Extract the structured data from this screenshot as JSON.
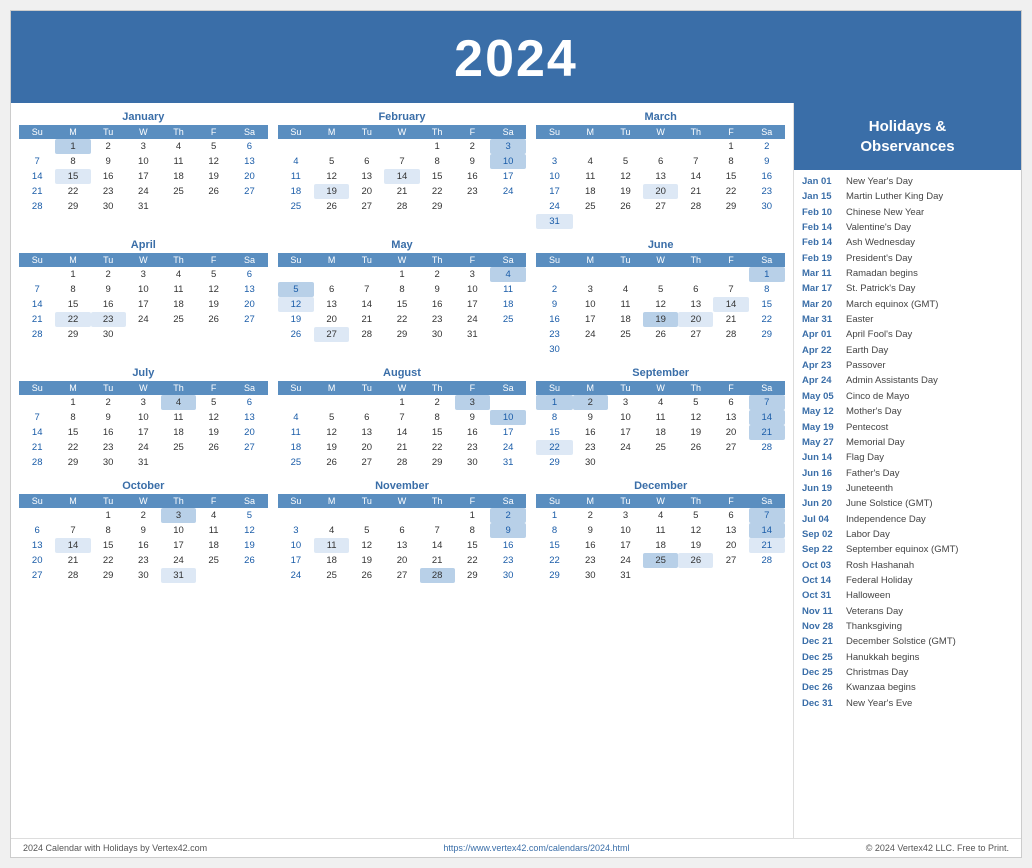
{
  "header": {
    "year": "2024"
  },
  "sidebar": {
    "title": "Holidays &\nObservances",
    "events": [
      {
        "date": "Jan 01",
        "event": "New Year's Day"
      },
      {
        "date": "Jan 15",
        "event": "Martin Luther King Day"
      },
      {
        "date": "Feb 10",
        "event": "Chinese New Year"
      },
      {
        "date": "Feb 14",
        "event": "Valentine's Day"
      },
      {
        "date": "Feb 14",
        "event": "Ash Wednesday"
      },
      {
        "date": "Feb 19",
        "event": "President's Day"
      },
      {
        "date": "Mar 11",
        "event": "Ramadan begins"
      },
      {
        "date": "Mar 17",
        "event": "St. Patrick's Day"
      },
      {
        "date": "Mar 20",
        "event": "March equinox (GMT)"
      },
      {
        "date": "Mar 31",
        "event": "Easter"
      },
      {
        "date": "Apr 01",
        "event": "April Fool's Day"
      },
      {
        "date": "Apr 22",
        "event": "Earth Day"
      },
      {
        "date": "Apr 23",
        "event": "Passover"
      },
      {
        "date": "Apr 24",
        "event": "Admin Assistants Day"
      },
      {
        "date": "May 05",
        "event": "Cinco de Mayo"
      },
      {
        "date": "May 12",
        "event": "Mother's Day"
      },
      {
        "date": "May 19",
        "event": "Pentecost"
      },
      {
        "date": "May 27",
        "event": "Memorial Day"
      },
      {
        "date": "Jun 14",
        "event": "Flag Day"
      },
      {
        "date": "Jun 16",
        "event": "Father's Day"
      },
      {
        "date": "Jun 19",
        "event": "Juneteenth"
      },
      {
        "date": "Jun 20",
        "event": "June Solstice (GMT)"
      },
      {
        "date": "Jul 04",
        "event": "Independence Day"
      },
      {
        "date": "Sep 02",
        "event": "Labor Day"
      },
      {
        "date": "Sep 22",
        "event": "September equinox (GMT)"
      },
      {
        "date": "Oct 03",
        "event": "Rosh Hashanah"
      },
      {
        "date": "Oct 14",
        "event": "Federal Holiday"
      },
      {
        "date": "Oct 31",
        "event": "Halloween"
      },
      {
        "date": "Nov 11",
        "event": "Veterans Day"
      },
      {
        "date": "Nov 28",
        "event": "Thanksgiving"
      },
      {
        "date": "Dec 21",
        "event": "December Solstice (GMT)"
      },
      {
        "date": "Dec 25",
        "event": "Hanukkah begins"
      },
      {
        "date": "Dec 25",
        "event": "Christmas Day"
      },
      {
        "date": "Dec 26",
        "event": "Kwanzaa begins"
      },
      {
        "date": "Dec 31",
        "event": "New Year's Eve"
      }
    ]
  },
  "footer": {
    "left": "2024 Calendar with Holidays by Vertex42.com",
    "center": "https://www.vertex42.com/calendars/2024.html",
    "right": "© 2024 Vertex42 LLC. Free to Print."
  },
  "months": [
    {
      "name": "January",
      "weeks": [
        [
          "",
          "1",
          "2",
          "3",
          "4",
          "5",
          "6"
        ],
        [
          "7",
          "8",
          "9",
          "10",
          "11",
          "12",
          "13"
        ],
        [
          "14",
          "15",
          "16",
          "17",
          "18",
          "19",
          "20"
        ],
        [
          "21",
          "22",
          "23",
          "24",
          "25",
          "26",
          "27"
        ],
        [
          "28",
          "29",
          "30",
          "31",
          "",
          "",
          ""
        ]
      ],
      "highlighted": {
        "1": "holiday",
        "15": "special"
      },
      "blue_sunday": []
    },
    {
      "name": "February",
      "weeks": [
        [
          "",
          "",
          "",
          "",
          "1",
          "2",
          "3"
        ],
        [
          "4",
          "5",
          "6",
          "7",
          "8",
          "9",
          "10"
        ],
        [
          "11",
          "12",
          "13",
          "14",
          "15",
          "16",
          "17"
        ],
        [
          "18",
          "19",
          "20",
          "21",
          "22",
          "23",
          "24"
        ],
        [
          "25",
          "26",
          "27",
          "28",
          "29",
          "",
          ""
        ]
      ],
      "highlighted": {
        "3": "saturday-blue",
        "10": "holiday",
        "14": "special",
        "19": "special"
      }
    },
    {
      "name": "March",
      "weeks": [
        [
          "",
          "",
          "",
          "",
          "",
          "1",
          "2"
        ],
        [
          "3",
          "4",
          "5",
          "6",
          "7",
          "8",
          "9"
        ],
        [
          "10",
          "11",
          "12",
          "13",
          "14",
          "15",
          "16"
        ],
        [
          "17",
          "18",
          "19",
          "20",
          "21",
          "22",
          "23"
        ],
        [
          "24",
          "25",
          "26",
          "27",
          "28",
          "29",
          "30"
        ],
        [
          "31",
          "",
          "",
          "",
          "",
          "",
          ""
        ]
      ],
      "highlighted": {
        "20": "special",
        "31": "special"
      }
    },
    {
      "name": "April",
      "weeks": [
        [
          "",
          "1",
          "2",
          "3",
          "4",
          "5",
          "6"
        ],
        [
          "7",
          "8",
          "9",
          "10",
          "11",
          "12",
          "13"
        ],
        [
          "14",
          "15",
          "16",
          "17",
          "18",
          "19",
          "20"
        ],
        [
          "21",
          "22",
          "23",
          "24",
          "25",
          "26",
          "27"
        ],
        [
          "28",
          "29",
          "30",
          "",
          "",
          "",
          ""
        ]
      ],
      "highlighted": {
        "22": "special",
        "23": "special"
      }
    },
    {
      "name": "May",
      "weeks": [
        [
          "",
          "",
          "",
          "1",
          "2",
          "3",
          "4"
        ],
        [
          "5",
          "6",
          "7",
          "8",
          "9",
          "10",
          "11"
        ],
        [
          "12",
          "13",
          "14",
          "15",
          "16",
          "17",
          "18"
        ],
        [
          "19",
          "20",
          "21",
          "22",
          "23",
          "24",
          "25"
        ],
        [
          "26",
          "27",
          "28",
          "29",
          "30",
          "31",
          ""
        ]
      ],
      "highlighted": {
        "4": "saturday-blue",
        "5": "holiday",
        "12": "special",
        "27": "special"
      }
    },
    {
      "name": "June",
      "weeks": [
        [
          "",
          "",
          "",
          "",
          "",
          "",
          "1"
        ],
        [
          "2",
          "3",
          "4",
          "5",
          "6",
          "7",
          "8"
        ],
        [
          "9",
          "10",
          "11",
          "12",
          "13",
          "14",
          "15"
        ],
        [
          "16",
          "17",
          "18",
          "19",
          "20",
          "21",
          "22"
        ],
        [
          "23",
          "24",
          "25",
          "26",
          "27",
          "28",
          "29"
        ],
        [
          "30",
          "",
          "",
          "",
          "",
          "",
          ""
        ]
      ],
      "highlighted": {
        "1": "saturday-blue",
        "14": "special",
        "19": "holiday",
        "20": "special"
      }
    },
    {
      "name": "July",
      "weeks": [
        [
          "",
          "1",
          "2",
          "3",
          "4",
          "5",
          "6"
        ],
        [
          "7",
          "8",
          "9",
          "10",
          "11",
          "12",
          "13"
        ],
        [
          "14",
          "15",
          "16",
          "17",
          "18",
          "19",
          "20"
        ],
        [
          "21",
          "22",
          "23",
          "24",
          "25",
          "26",
          "27"
        ],
        [
          "28",
          "29",
          "30",
          "31",
          "",
          "",
          ""
        ]
      ],
      "highlighted": {
        "4": "holiday"
      }
    },
    {
      "name": "August",
      "weeks": [
        [
          "",
          "",
          "",
          "1",
          "2",
          "3",
          ""
        ],
        [
          "4",
          "5",
          "6",
          "7",
          "8",
          "9",
          "10"
        ],
        [
          "11",
          "12",
          "13",
          "14",
          "15",
          "16",
          "17"
        ],
        [
          "18",
          "19",
          "20",
          "21",
          "22",
          "23",
          "24"
        ],
        [
          "25",
          "26",
          "27",
          "28",
          "29",
          "30",
          "31"
        ]
      ],
      "highlighted": {
        "3": "saturday-blue",
        "10": "saturday-blue"
      }
    },
    {
      "name": "September",
      "weeks": [
        [
          "1",
          "2",
          "3",
          "4",
          "5",
          "6",
          "7"
        ],
        [
          "8",
          "9",
          "10",
          "11",
          "12",
          "13",
          "14"
        ],
        [
          "15",
          "16",
          "17",
          "18",
          "19",
          "20",
          "21"
        ],
        [
          "22",
          "23",
          "24",
          "25",
          "26",
          "27",
          "28"
        ],
        [
          "29",
          "30",
          "",
          "",
          "",
          "",
          ""
        ]
      ],
      "highlighted": {
        "1": "holiday",
        "2": "holiday",
        "7": "saturday-blue",
        "14": "saturday-blue",
        "21": "saturday-blue",
        "22": "special"
      }
    },
    {
      "name": "October",
      "weeks": [
        [
          "",
          "",
          "1",
          "2",
          "3",
          "4",
          "5"
        ],
        [
          "6",
          "7",
          "8",
          "9",
          "10",
          "11",
          "12"
        ],
        [
          "13",
          "14",
          "15",
          "16",
          "17",
          "18",
          "19"
        ],
        [
          "20",
          "21",
          "22",
          "23",
          "24",
          "25",
          "26"
        ],
        [
          "27",
          "28",
          "29",
          "30",
          "31",
          "",
          ""
        ]
      ],
      "highlighted": {
        "3": "holiday",
        "14": "special",
        "31": "special"
      }
    },
    {
      "name": "November",
      "weeks": [
        [
          "",
          "",
          "",
          "",
          "",
          "1",
          "2"
        ],
        [
          "3",
          "4",
          "5",
          "6",
          "7",
          "8",
          "9"
        ],
        [
          "10",
          "11",
          "12",
          "13",
          "14",
          "15",
          "16"
        ],
        [
          "17",
          "18",
          "19",
          "20",
          "21",
          "22",
          "23"
        ],
        [
          "24",
          "25",
          "26",
          "27",
          "28",
          "29",
          "30"
        ]
      ],
      "highlighted": {
        "2": "saturday-blue",
        "9": "saturday-blue",
        "11": "special",
        "28": "holiday"
      }
    },
    {
      "name": "December",
      "weeks": [
        [
          "1",
          "2",
          "3",
          "4",
          "5",
          "6",
          "7"
        ],
        [
          "8",
          "9",
          "10",
          "11",
          "12",
          "13",
          "14"
        ],
        [
          "15",
          "16",
          "17",
          "18",
          "19",
          "20",
          "21"
        ],
        [
          "22",
          "23",
          "24",
          "25",
          "26",
          "27",
          "28"
        ],
        [
          "29",
          "30",
          "31",
          "",
          "",
          "",
          ""
        ]
      ],
      "highlighted": {
        "7": "saturday-blue",
        "14": "saturday-blue",
        "21": "special",
        "25": "holiday",
        "26": "special"
      }
    }
  ]
}
